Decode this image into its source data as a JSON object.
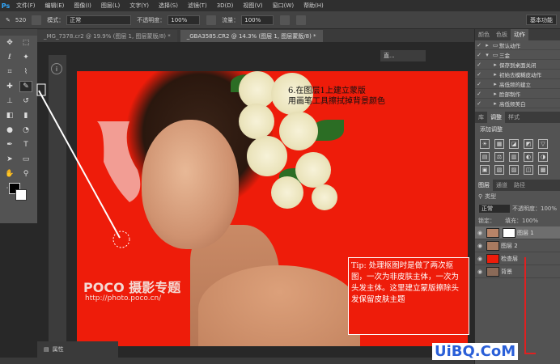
{
  "menubar": {
    "logo": "Ps",
    "items": [
      "文件(F)",
      "编辑(E)",
      "图像(I)",
      "图层(L)",
      "文字(Y)",
      "选择(S)",
      "滤镜(T)",
      "3D(D)",
      "视图(V)",
      "窗口(W)",
      "帮助(H)"
    ]
  },
  "options": {
    "brush_size": "520",
    "mode_label": "模式：",
    "mode_value": "正常",
    "opacity_label": "不透明度：",
    "opacity_value": "100%",
    "flow_label": "流量：",
    "flow_value": "100%",
    "preset": "基本功能"
  },
  "tabs": [
    {
      "label": "_MG_7378.cr2 @ 19.9% (图层 1, 图层蒙版/8) *",
      "active": false
    },
    {
      "label": "_GBA3585.CR2 @ 14.3% (图层 1, 图层蒙版/8) *",
      "active": true
    }
  ],
  "canvas": {
    "doc_title": "直...",
    "watermark_logo": "POCO 摄影专题",
    "watermark_url": "http://photo.poco.cn/",
    "step_note": "6.在图层1上建立蒙版\n用画笔工具擦拭掉背景颜色",
    "tip": "Tip: 处理抠图时是做了两次抠图，一次为非皮肤主体，一次为头发主体。这里建立蒙版擦除头发保留皮肤主题"
  },
  "properties_label": "属性",
  "actions_panel": {
    "tabs": [
      "颜色",
      "色板",
      "动作"
    ],
    "rows": [
      "默认动作",
      "三金",
      "保存到桌面关闭",
      "初始去模糊皮动作",
      "高低频的建立",
      "脸部制作",
      "高低频美白"
    ]
  },
  "adjust_panel": {
    "tabs": [
      "库",
      "调整",
      "样式"
    ],
    "title": "添加调整",
    "icons": [
      "☀",
      "▦",
      "◪",
      "◩",
      "▽",
      "▤",
      "⚖",
      "▥",
      "◐",
      "◑",
      "▣",
      "▧",
      "▨",
      "◫",
      "▩"
    ]
  },
  "layers_panel": {
    "tabs": [
      "图层",
      "通道",
      "路径"
    ],
    "kind": "类型",
    "blend": "正常",
    "opacity_label": "不透明度：",
    "opacity": "100%",
    "lock_label": "锁定：",
    "fill_label": "填充：",
    "fill": "100%",
    "layers": [
      {
        "name": "图层 1",
        "selected": true
      },
      {
        "name": "图层 2",
        "selected": false
      },
      {
        "name": "检查层",
        "selected": false
      },
      {
        "name": "背景",
        "selected": false
      }
    ]
  },
  "site_watermark": "UiBQ.CoM"
}
